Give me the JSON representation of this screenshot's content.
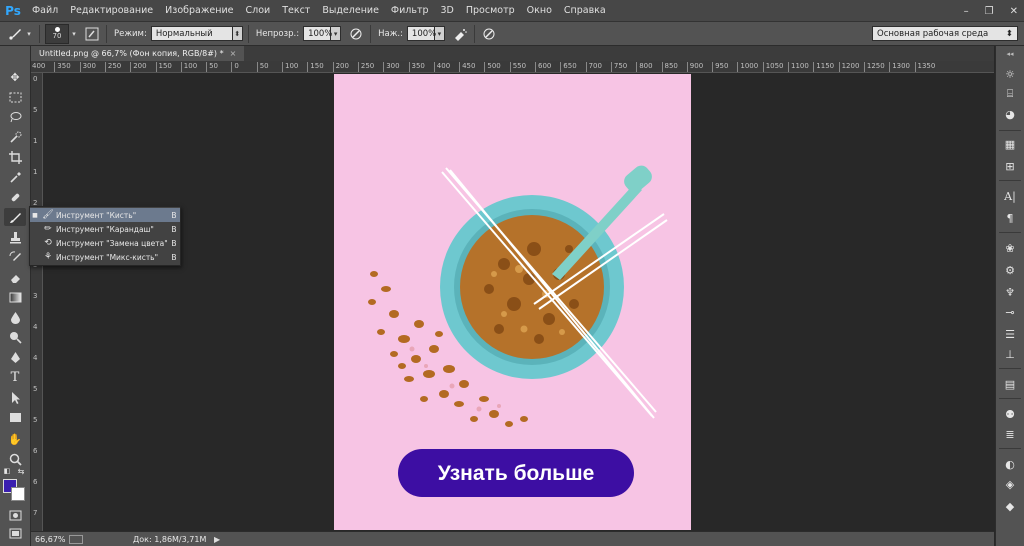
{
  "app": {
    "logo": "Ps",
    "menu": [
      "Файл",
      "Редактирование",
      "Изображение",
      "Слои",
      "Текст",
      "Выделение",
      "Фильтр",
      "3D",
      "Просмотр",
      "Окно",
      "Справка"
    ],
    "window_controls": [
      "–",
      "❐",
      "✕"
    ]
  },
  "options": {
    "brush_size": "70",
    "mode_label": "Режим:",
    "mode_value": "Нормальный",
    "opacity_label": "Непрозр.:",
    "opacity_value": "100%",
    "pressure_label": "Наж.:",
    "pressure_value": "100%",
    "workspace": "Основная рабочая среда"
  },
  "document": {
    "tab_title": "Untitled.png @ 66,7% (Фон копия, RGB/8#) *",
    "tab_close": "×"
  },
  "ruler": {
    "top": [
      "400",
      "350",
      "300",
      "250",
      "200",
      "150",
      "100",
      "50",
      "0",
      "50",
      "100",
      "150",
      "200",
      "250",
      "300",
      "350",
      "400",
      "450",
      "500",
      "550",
      "600",
      "650",
      "700",
      "750",
      "800",
      "850",
      "900",
      "950",
      "1000",
      "1050",
      "1100",
      "1150",
      "1200",
      "1250",
      "1300",
      "1350"
    ],
    "left": [
      "0",
      "5",
      "1",
      "1",
      "2",
      "2",
      "3",
      "3",
      "4",
      "4",
      "5",
      "5",
      "6",
      "6",
      "7"
    ]
  },
  "flyout": {
    "items": [
      {
        "label": "Инструмент \"Кисть\"",
        "key": "B",
        "icon": "brush-icon"
      },
      {
        "label": "Инструмент \"Карандаш\"",
        "key": "B",
        "icon": "pencil-icon"
      },
      {
        "label": "Инструмент \"Замена цвета\"",
        "key": "B",
        "icon": "color-replacement-icon"
      },
      {
        "label": "Инструмент \"Микс-кисть\"",
        "key": "B",
        "icon": "mixer-brush-icon"
      }
    ]
  },
  "artwork": {
    "cta_text": "Узнать больше"
  },
  "status": {
    "zoom": "66,67%",
    "doc_info": "Док: 1,86M/3,71M",
    "arrow": "▶"
  },
  "colors": {
    "foreground": "#3a1fb0",
    "background": "#ffffff",
    "artboard_bg": "#f7c4e4",
    "cta_bg": "#3d0ea3",
    "bowl": "#6ec8cf"
  }
}
